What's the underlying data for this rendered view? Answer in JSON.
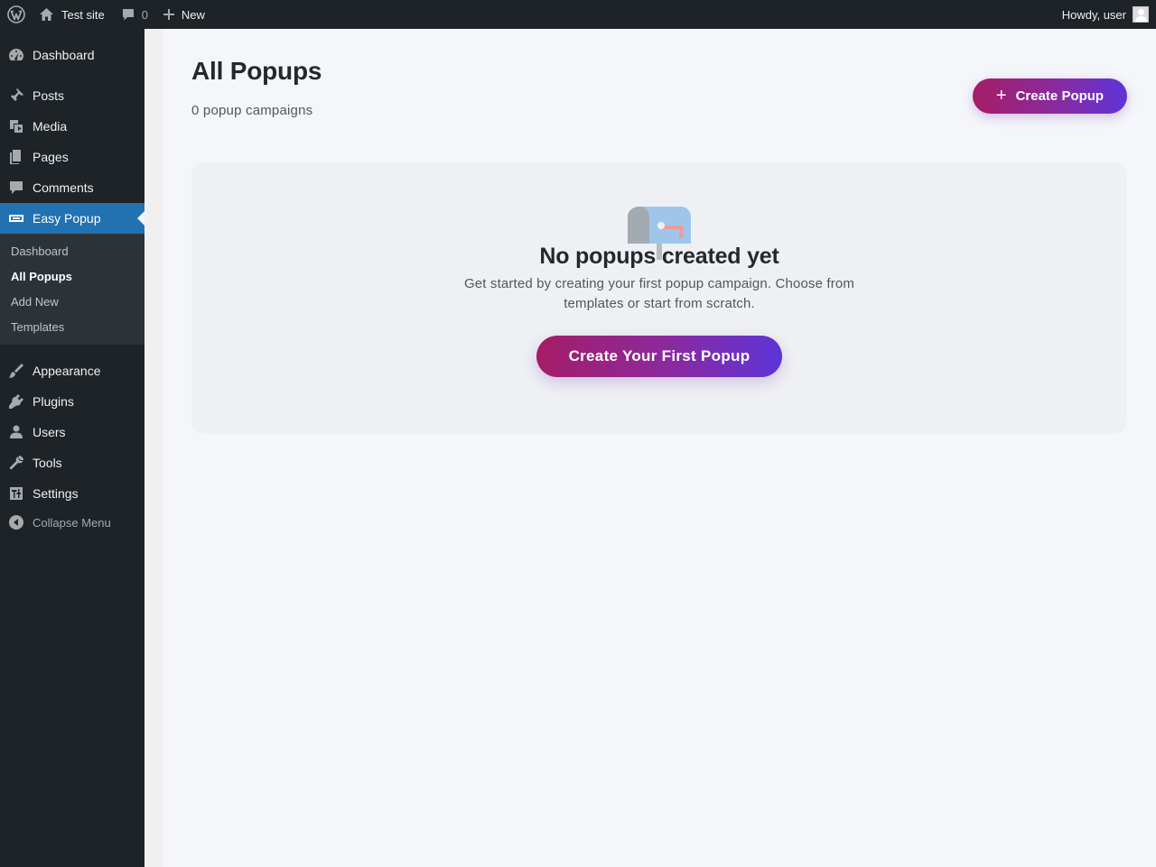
{
  "admin_bar": {
    "site_name": "Test site",
    "comments_count": "0",
    "new_label": "New",
    "greeting": "Howdy, user"
  },
  "sidebar": {
    "items": [
      {
        "label": "Dashboard",
        "icon": "dashboard-icon"
      },
      {
        "label": "Posts",
        "icon": "pin-icon"
      },
      {
        "label": "Media",
        "icon": "media-icon"
      },
      {
        "label": "Pages",
        "icon": "pages-icon"
      },
      {
        "label": "Comments",
        "icon": "comment-icon"
      },
      {
        "label": "Easy Popup",
        "icon": "popup-icon",
        "current": true
      },
      {
        "label": "Appearance",
        "icon": "brush-icon"
      },
      {
        "label": "Plugins",
        "icon": "plug-icon"
      },
      {
        "label": "Users",
        "icon": "user-icon"
      },
      {
        "label": "Tools",
        "icon": "wrench-icon"
      },
      {
        "label": "Settings",
        "icon": "settings-icon"
      }
    ],
    "submenu": [
      "Dashboard",
      "All Popups",
      "Add New",
      "Templates"
    ],
    "submenu_active": "All Popups",
    "collapse_label": "Collapse Menu"
  },
  "main": {
    "title": "All Popups",
    "subtitle": "0 popup campaigns",
    "create_button": "Create Popup",
    "create_button_icon": "plus-icon",
    "empty_state": {
      "icon": "mailbox-icon",
      "title": "No popups created yet",
      "description": "Get started by creating your first popup campaign. Choose from templates or start from scratch.",
      "button": "Create Your First Popup"
    }
  },
  "colors": {
    "admin_bar": "#1d2327",
    "sidebar": "#1d2327",
    "submenu": "#2c3338",
    "current_menu": "#2271b1",
    "gradient_start": "#a51d66",
    "gradient_end": "#5d34d8"
  }
}
